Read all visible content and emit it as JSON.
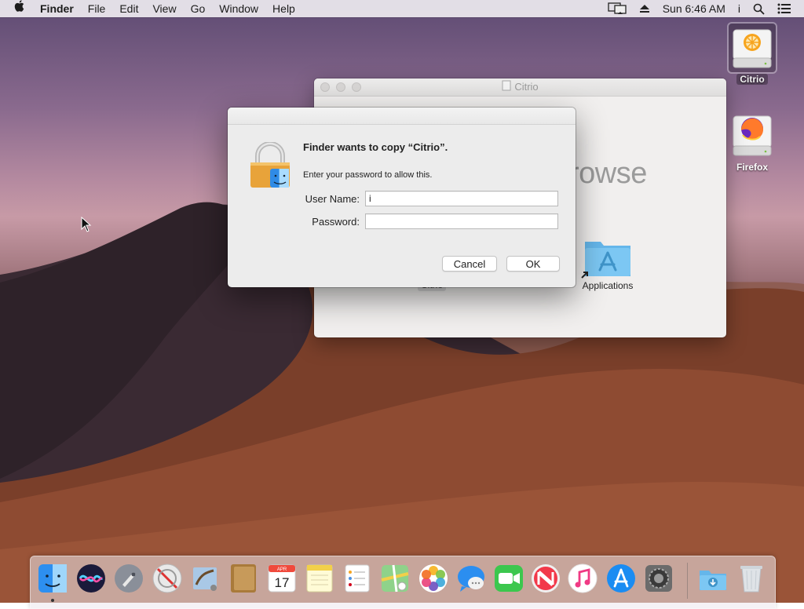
{
  "menubar": {
    "apple_icon": "apple-logo",
    "app_name": "Finder",
    "items": [
      "File",
      "Edit",
      "View",
      "Go",
      "Window",
      "Help"
    ],
    "status": {
      "display_icon": "airplay-display-icon",
      "eject_icon": "eject-icon",
      "clock": "Sun 6:46 AM",
      "user": "i",
      "search_icon": "spotlight-search-icon",
      "notifications_icon": "notification-center-icon"
    }
  },
  "desktop_icons": [
    {
      "label": "Citrio",
      "icon": "disk-image-drive-icon",
      "selected": true
    },
    {
      "label": "Firefox",
      "icon": "firefox-drive-icon",
      "selected": false
    }
  ],
  "finder_window": {
    "title": "Citrio",
    "background_text": "rowse",
    "items": [
      {
        "label": "Citrio",
        "icon": "citrio-app-icon"
      },
      {
        "label": "Applications",
        "icon": "applications-folder-alias-icon"
      }
    ]
  },
  "auth_dialog": {
    "title": "Finder wants to copy “Citrio”.",
    "message": "Enter your password to allow this.",
    "username_label": "User Name:",
    "username_value": "i",
    "password_label": "Password:",
    "password_value": "",
    "cancel_label": "Cancel",
    "ok_label": "OK",
    "icon": "lock-finder-icon"
  },
  "dock": {
    "apps": [
      "Finder",
      "Siri",
      "Launchpad",
      "Safari",
      "Mail",
      "Contacts",
      "Calendar",
      "Notes",
      "Reminders",
      "Maps",
      "Photos",
      "Messages",
      "FaceTime",
      "News",
      "iTunes",
      "App Store",
      "System Preferences"
    ],
    "calendar_month": "APR",
    "calendar_day": "17",
    "trailing": [
      "Downloads",
      "Trash"
    ]
  },
  "colors": {
    "accent_blue": "#1a82fb",
    "dialog_bg": "#ececec",
    "lock_gold": "#e8a33a"
  }
}
